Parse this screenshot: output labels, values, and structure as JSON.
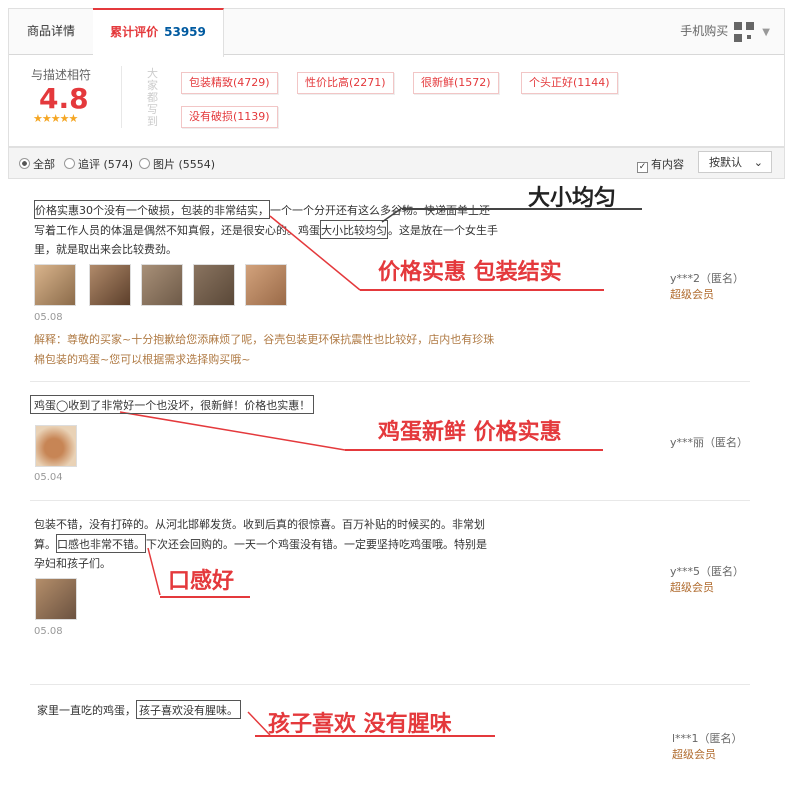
{
  "tabs": {
    "details": "商品详情",
    "reviews": "累计评价",
    "reviews_count": "53959",
    "mobile_buy": "手机购买"
  },
  "rating": {
    "label": "与描述相符",
    "score": "4.8",
    "stars": "★★★★★",
    "vertical_text": "大家都写到"
  },
  "tags": [
    "包装精致(4729)",
    "性价比高(2271)",
    "很新鲜(1572)",
    "个头正好(1144)",
    "没有破损(1139)"
  ],
  "filters": {
    "all": "全部",
    "followup": "追评 (574)",
    "images": "图片 (5554)",
    "has_content": "有内容",
    "sort": "按默认"
  },
  "reviews": [
    {
      "line1_box": "价格实惠30个没有一个破损，包装的非常结实，",
      "line1_rest": "一个一个分开还有这么多谷物。快递面单上还",
      "line2_start": "写着工作人员的体温是偶然不知真假，还是很安心的。鸡蛋",
      "line2_box": "大小比较均匀",
      "line2_rest": "。这是放在一个女生手",
      "line3": "里，就是取出来会比较费劲。",
      "date": "05.08",
      "user": "y***2（匿名）",
      "member": "超级会员",
      "reply": "解释：尊敬的买家~十分抱歉给您添麻烦了呢，谷壳包装更环保抗震性也比较好，店内也有珍珠棉包装的鸡蛋~您可以根据需求选择购买哦~",
      "callout1": "大小均匀",
      "callout2": "价格实惠 包装结实"
    },
    {
      "text": "鸡蛋◯收到了非常好一个也没坏，很新鲜！价格也实惠！",
      "date": "05.04",
      "user": "y***丽（匿名）",
      "callout": "鸡蛋新鲜 价格实惠"
    },
    {
      "line1": "包装不错，没有打碎的。从河北邯郸发货。收到后真的很惊喜。百万补贴的时候买的。非常划",
      "line2_start": "算。",
      "line2_box": "口感也非常不错。",
      "line2_rest": "下次还会回购的。一天一个鸡蛋没有错。一定要坚持吃鸡蛋哦。特别是",
      "line3": "孕妇和孩子们。",
      "date": "05.08",
      "user": "y***5（匿名）",
      "member": "超级会员",
      "callout": "口感好"
    },
    {
      "text_start": "家里一直吃的鸡蛋，",
      "text_box": "孩子喜欢没有腥味。",
      "user": "l***1（匿名）",
      "member": "超级会员",
      "callout": "孩子喜欢 没有腥味"
    }
  ]
}
